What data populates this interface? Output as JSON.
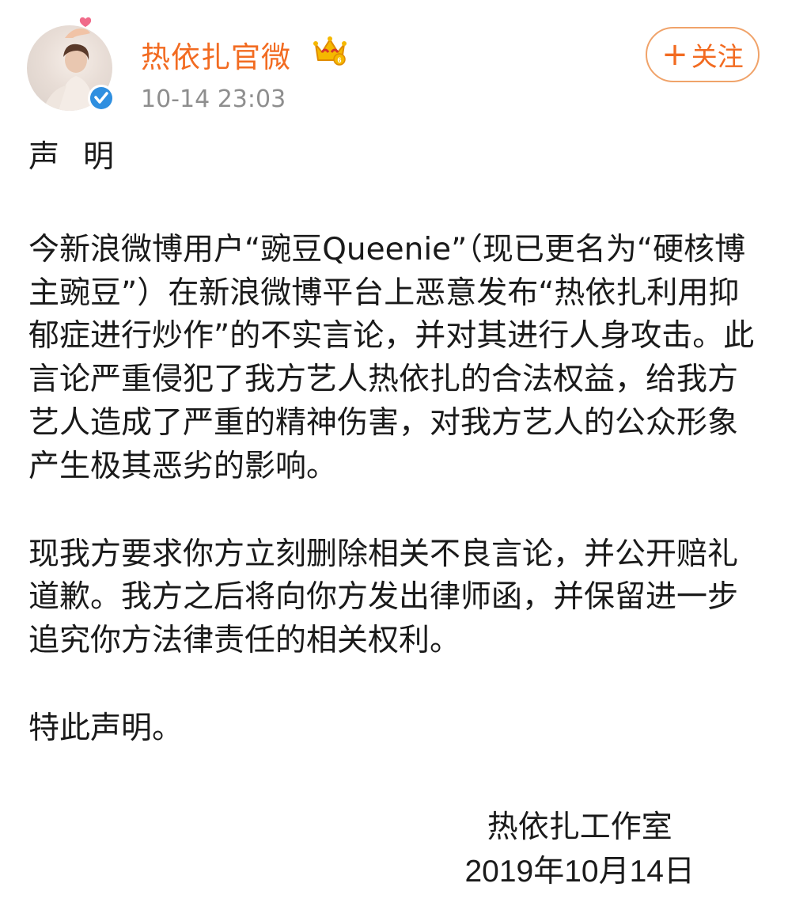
{
  "post": {
    "author": "热依扎官微",
    "timestamp": "10-14 23:03",
    "follow_label": "关注",
    "follow_icon": "plus",
    "badges": [
      "verified-badge",
      "vip-crown-icon"
    ],
    "content": {
      "title": "声明",
      "paragraph1": "今新浪微博用户“豌豆Queenie”（现已更名为“硬核博主豌豆”）在新浪微博平台上恶意发布“热依扎利用抑郁症进行炒作”的不实言论，并对其进行人身攻击。此言论严重侵犯了我方艺人热依扎的合法权益，给我方艺人造成了严重的精神伤害，对我方艺人的公众形象产生极其恶劣的影响。",
      "paragraph2": "现我方要求你方立刻删除相关不良言论，并公开赔礼道歉。我方之后将向你方发出律师函，并保留进一步追究你方法律责任的相关权利。",
      "closing": "特此声明。",
      "signature_org": "热依扎工作室",
      "signature_date": "2019年10月14日"
    }
  },
  "colors": {
    "accent": "#f26b21",
    "timestamp": "#8e8e8e",
    "text": "#1a1a1a",
    "verified": "#2f8fe0",
    "crown": "#f5b800"
  }
}
